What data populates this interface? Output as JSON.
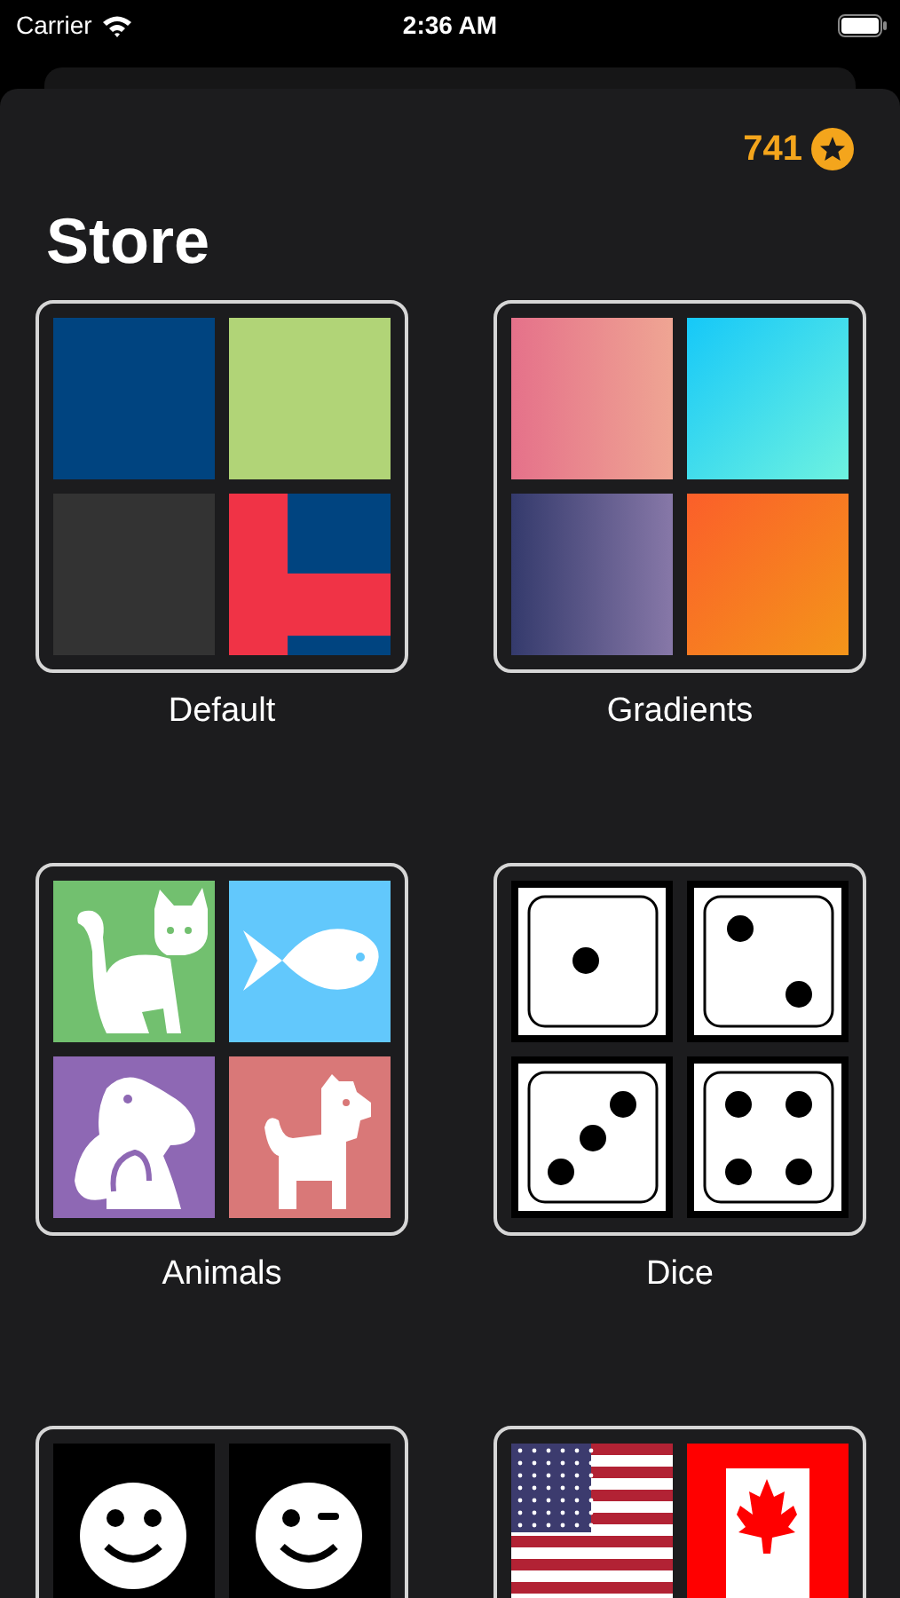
{
  "status_bar": {
    "carrier": "Carrier",
    "time": "2:36 AM"
  },
  "balance": {
    "amount": "741"
  },
  "title": "Store",
  "packs": [
    {
      "name": "Default",
      "kind": "default"
    },
    {
      "name": "Gradients",
      "kind": "gradients"
    },
    {
      "name": "Animals",
      "kind": "animals"
    },
    {
      "name": "Dice",
      "kind": "dice"
    },
    {
      "kind": "faces"
    },
    {
      "kind": "flags"
    }
  ]
}
